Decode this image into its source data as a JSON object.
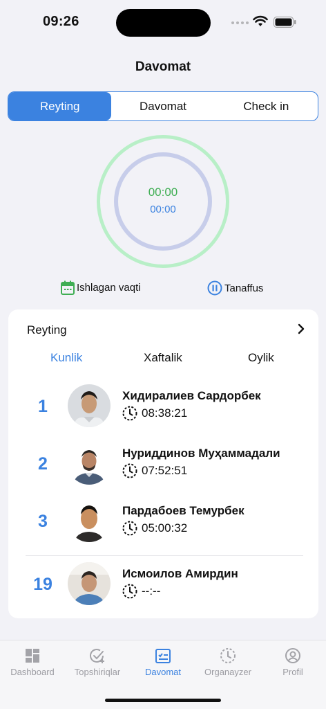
{
  "status_bar": {
    "time": "09:26"
  },
  "header": {
    "title": "Davomat"
  },
  "segments": [
    "Reyting",
    "Davomat",
    "Check in"
  ],
  "timer": {
    "work_time": "00:00",
    "break_time": "00:00",
    "work_label": "Ishlagan vaqti",
    "break_label": "Tanaffus"
  },
  "rating": {
    "title": "Reyting",
    "periods": [
      "Kunlik",
      "Xaftalik",
      "Oylik"
    ],
    "rows": [
      {
        "rank": "1",
        "name": "Хидиралиев Сардорбек",
        "time": "08:38:21"
      },
      {
        "rank": "2",
        "name": "Нуриддинов Муҳаммадали",
        "time": "07:52:51"
      },
      {
        "rank": "3",
        "name": "Пардабоев Темурбек",
        "time": "05:00:32"
      },
      {
        "rank": "19",
        "name": "Исмоилов Амирдин",
        "time": "--:--"
      }
    ]
  },
  "tabbar": {
    "items": [
      {
        "label": "Dashboard",
        "icon": "grid-icon"
      },
      {
        "label": "Topshiriqlar",
        "icon": "task-check-icon"
      },
      {
        "label": "Davomat",
        "icon": "attendance-icon"
      },
      {
        "label": "Organayzer",
        "icon": "clock-dashed-icon"
      },
      {
        "label": "Profil",
        "icon": "user-circle-icon"
      }
    ]
  },
  "colors": {
    "accent": "#3b82e0",
    "work_green": "#3fae53",
    "outer_ring": "#b8efc7",
    "inner_ring": "#c7cdea"
  }
}
